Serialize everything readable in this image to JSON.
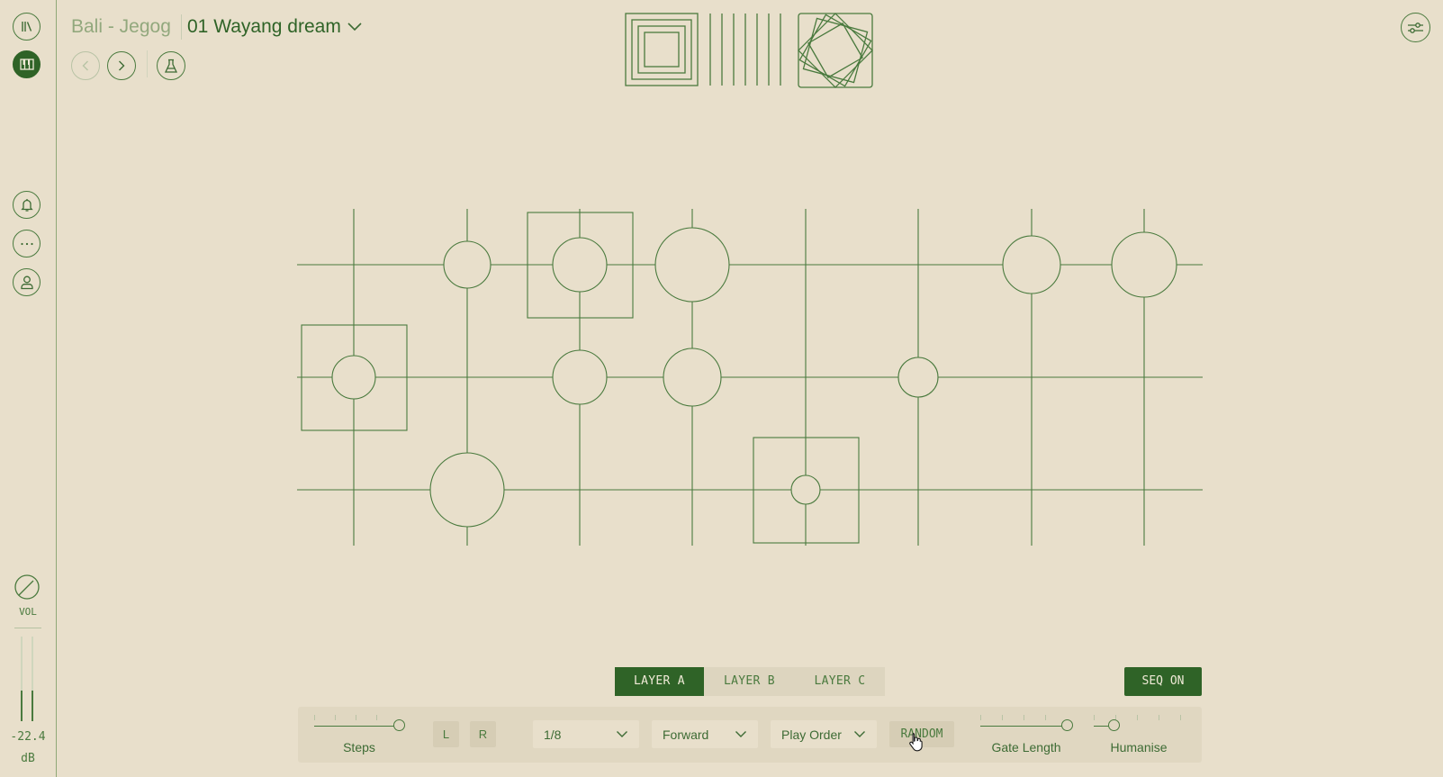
{
  "header": {
    "instrument": "Bali - Jegog",
    "preset": "01 Wayang dream"
  },
  "sidebar": {
    "items": [
      {
        "name": "library",
        "icon": "library-icon"
      },
      {
        "name": "instrument",
        "icon": "piano-keys-icon",
        "active": true
      },
      {
        "name": "notifications",
        "icon": "bell-icon"
      },
      {
        "name": "more",
        "icon": "more-horizontal-icon"
      },
      {
        "name": "account",
        "icon": "user-icon"
      }
    ],
    "vol_label": "VOL",
    "db_value": "-22.4",
    "db_unit": "dB",
    "meter_levels": [
      0.36,
      0.36
    ]
  },
  "nav": {
    "back_icon": "chevron-left-icon",
    "forward_icon": "chevron-right-icon",
    "lab_icon": "flask-icon",
    "settings_icon": "sliders-icon"
  },
  "sequencer": {
    "columns": 8,
    "rows": 3,
    "layer_a_pattern": [
      {
        "col": 1,
        "row": 2,
        "size": "small",
        "selected": true
      },
      {
        "col": 2,
        "row": 1,
        "size": "small"
      },
      {
        "col": 2,
        "row": 3,
        "size": "large"
      },
      {
        "col": 3,
        "row": 1,
        "size": "medium",
        "selected": true
      },
      {
        "col": 3,
        "row": 2,
        "size": "medium"
      },
      {
        "col": 4,
        "row": 1,
        "size": "large"
      },
      {
        "col": 4,
        "row": 2,
        "size": "medium"
      },
      {
        "col": 5,
        "row": 3,
        "size": "tiny",
        "selected": true
      },
      {
        "col": 6,
        "row": 2,
        "size": "small"
      },
      {
        "col": 7,
        "row": 1,
        "size": "medium"
      },
      {
        "col": 8,
        "row": 1,
        "size": "medium-large"
      }
    ]
  },
  "layers": {
    "tabs": [
      {
        "label": "LAYER A",
        "active": true
      },
      {
        "label": "LAYER B",
        "active": false
      },
      {
        "label": "LAYER C",
        "active": false
      }
    ],
    "seq_button": "SEQ ON"
  },
  "controls": {
    "steps": {
      "label": "Steps",
      "value_fraction": 1.0
    },
    "left_button": "L",
    "right_button": "R",
    "rate": {
      "value": "1/8"
    },
    "direction": {
      "value": "Forward"
    },
    "order": {
      "value": "Play Order"
    },
    "random_button": "RANDOM",
    "gate_length": {
      "label": "Gate Length",
      "value_fraction": 1.0
    },
    "humanise": {
      "label": "Humanise",
      "value_fraction": 0.2
    }
  },
  "colors": {
    "background": "#e8dfcb",
    "accent": "#2f6327",
    "line": "#4a7a3e",
    "muted": "#92a87d"
  }
}
